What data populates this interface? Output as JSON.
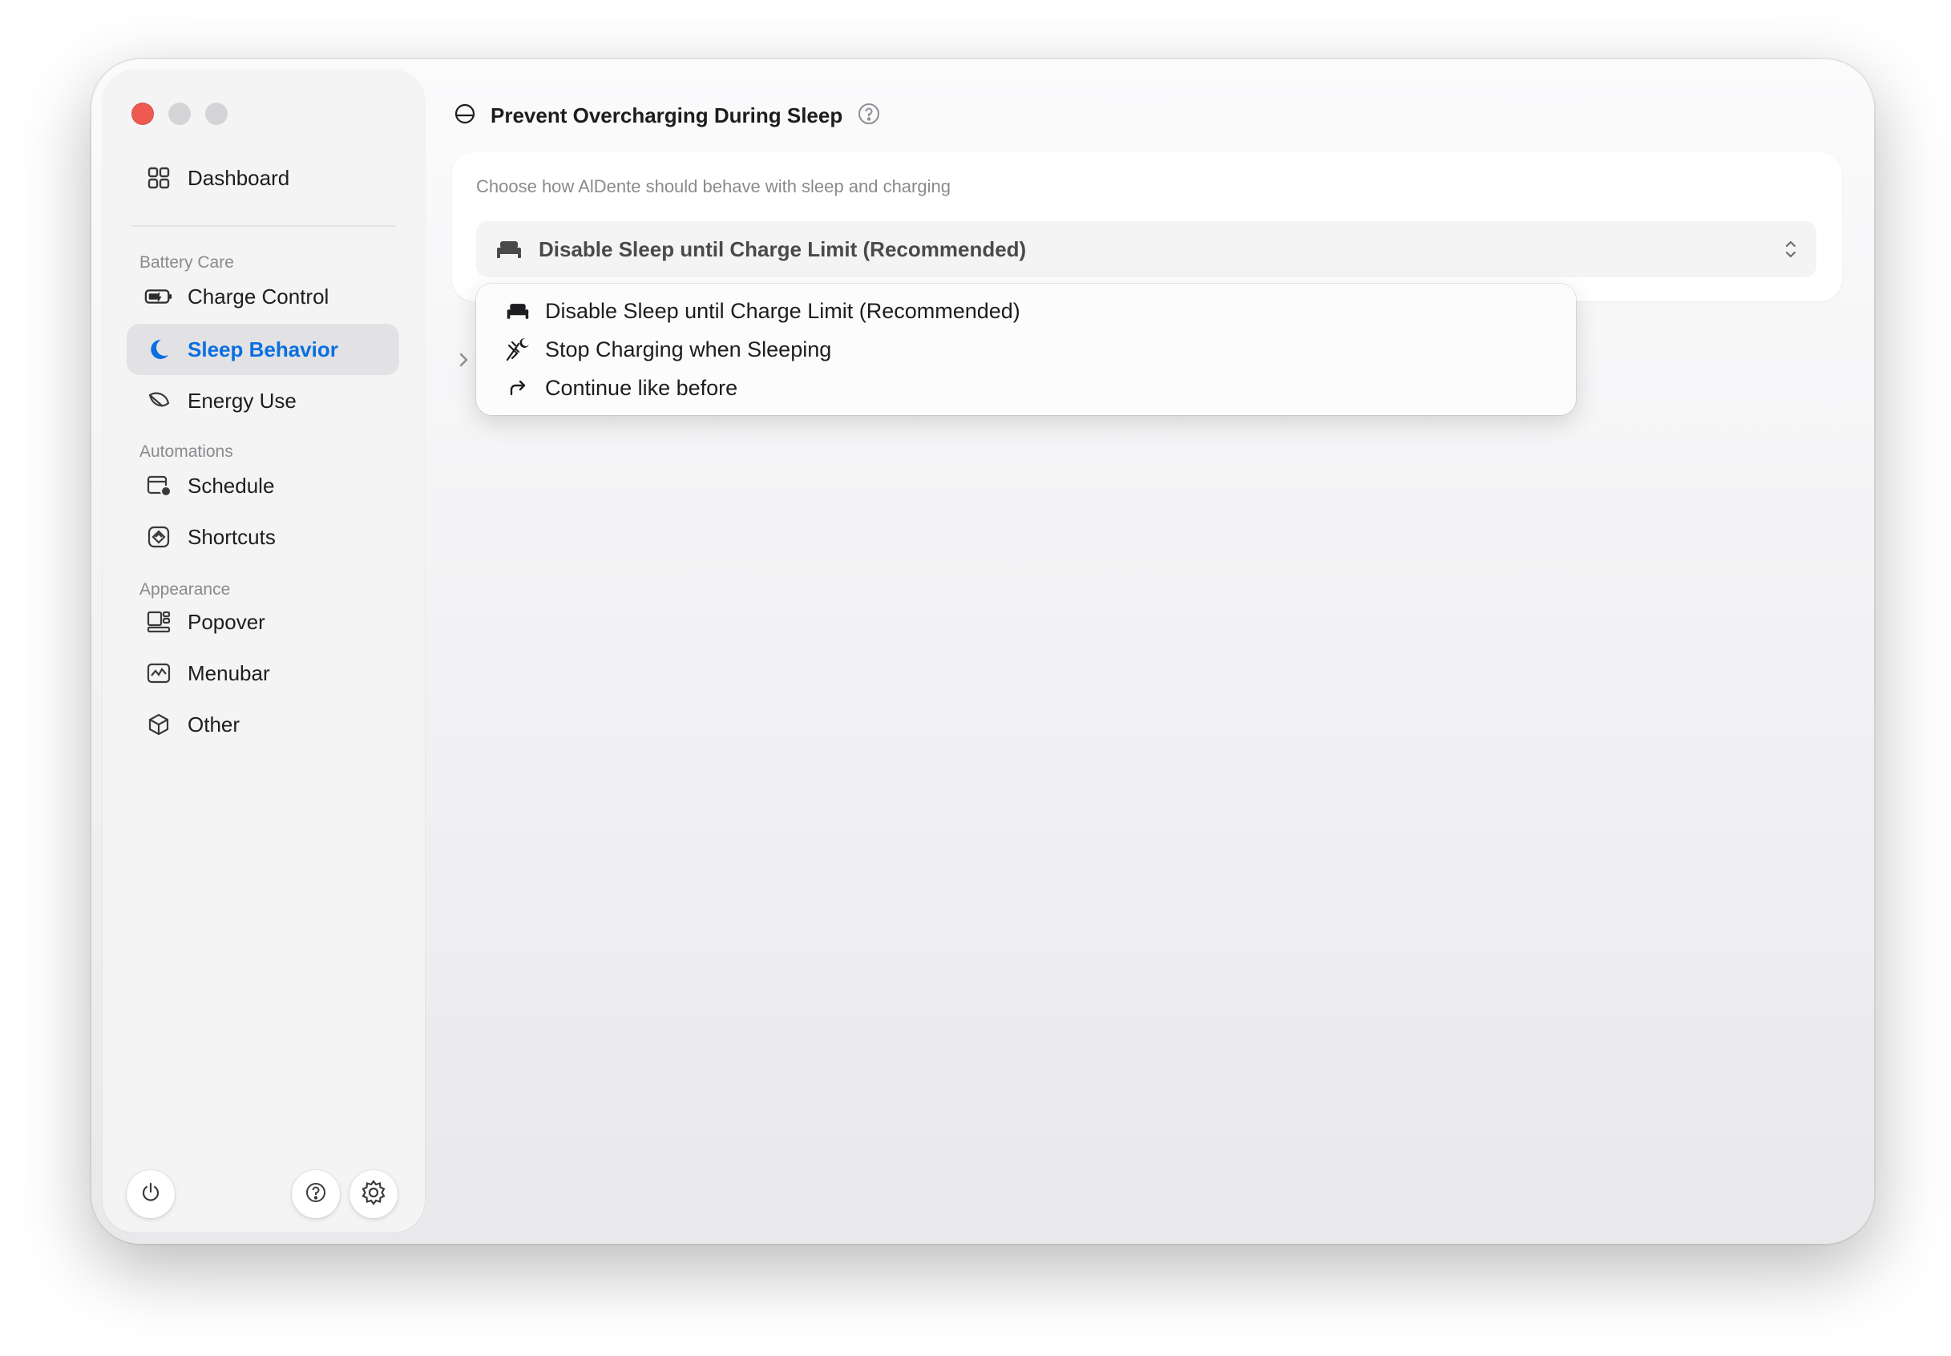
{
  "window": {
    "traffic_lights": [
      "close",
      "minimize",
      "maximize"
    ]
  },
  "sidebar": {
    "top_item": {
      "label": "Dashboard",
      "icon": "grid-icon"
    },
    "sections": [
      {
        "title": "Battery Care",
        "items": [
          {
            "label": "Charge Control",
            "icon": "battery-icon"
          },
          {
            "label": "Sleep Behavior",
            "icon": "moon-icon",
            "active": true
          },
          {
            "label": "Energy Use",
            "icon": "leaf-icon"
          }
        ]
      },
      {
        "title": "Automations",
        "items": [
          {
            "label": "Schedule",
            "icon": "calendar-clock-icon"
          },
          {
            "label": "Shortcuts",
            "icon": "shortcuts-icon"
          }
        ]
      },
      {
        "title": "Appearance",
        "items": [
          {
            "label": "Popover",
            "icon": "popover-icon"
          },
          {
            "label": "Menubar",
            "icon": "menubar-icon"
          },
          {
            "label": "Other",
            "icon": "cube-icon"
          }
        ]
      }
    ],
    "accent_color": "#0a6fe0"
  },
  "header": {
    "title": "Prevent Overcharging During Sleep"
  },
  "card": {
    "description": "Choose how AlDente should behave with sleep and charging",
    "selected": "Disable Sleep until Charge Limit (Recommended)"
  },
  "dropdown": {
    "options": [
      {
        "label": "Disable Sleep until Charge Limit (Recommended)",
        "icon": "bed-icon"
      },
      {
        "label": "Stop Charging when Sleeping",
        "icon": "no-plug-moon-icon"
      },
      {
        "label": "Continue like before",
        "icon": "arrow-forward-icon"
      }
    ]
  }
}
